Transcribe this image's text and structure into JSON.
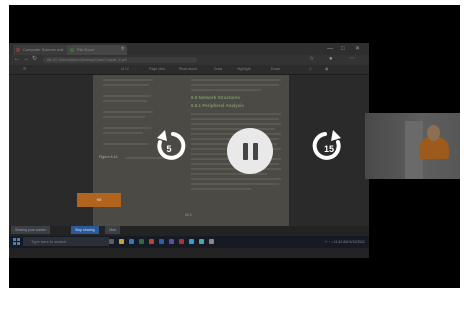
{
  "browser": {
    "tabs": [
      {
        "label": "Computer Science unit"
      },
      {
        "label": "File Excel"
      }
    ],
    "new_tab_label": "+",
    "controls": {
      "minimize": "—",
      "maximize": "□",
      "close": "✕"
    },
    "url": "file:///C:/Users/Admin/Desktop/Class/Chapter_6.pdf"
  },
  "pdf_toolbar": {
    "items": [
      "of 12",
      "Page view",
      "Read aloud",
      "Draw",
      "Highlight",
      "Erase"
    ]
  },
  "document": {
    "heading_1": "6.5 Network Structures",
    "heading_2": "6.5.1 Peripheral Analysis",
    "figure_caption": "Figure 6.14",
    "page_number": "6/12",
    "orange_label": "NB"
  },
  "notification_chips": {
    "sharing_text": "Sharing your screen",
    "stop_label": "Stop sharing",
    "hide_label": "Hide"
  },
  "taskbar": {
    "search_placeholder": "Type here to search",
    "time": "11:42 AM",
    "date": "5/12/2021"
  },
  "player": {
    "rewind_seconds": "5",
    "forward_seconds": "15",
    "state": "playing"
  },
  "colors": {
    "page_background": "#ffffff",
    "video_background": "#000000",
    "orange_accent": "#b0641e",
    "play_button": "#e9e9e9"
  }
}
